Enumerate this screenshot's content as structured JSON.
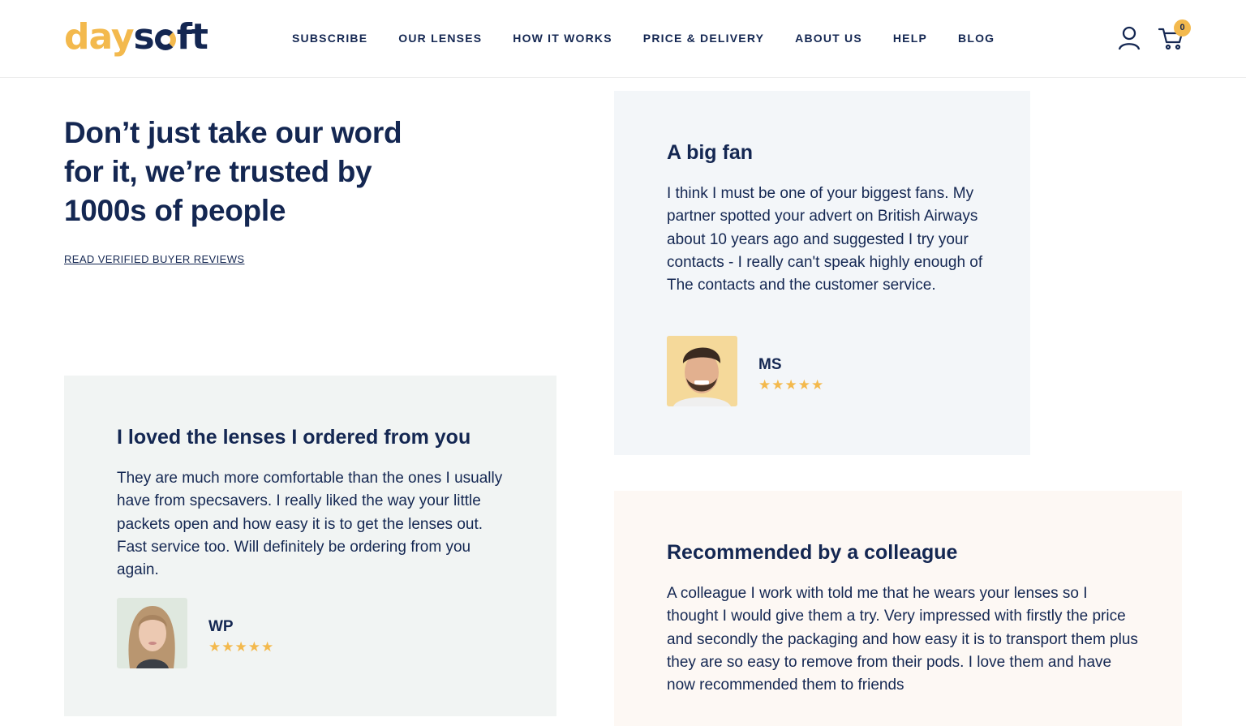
{
  "brand": {
    "logo_part1": "day",
    "logo_part2": "s",
    "logo_part3": "ft",
    "logo_primary_color": "#142752",
    "logo_accent_color": "#f3b94d"
  },
  "nav": {
    "items": [
      "SUBSCRIBE",
      "OUR LENSES",
      "HOW IT WORKS",
      "PRICE & DELIVERY",
      "ABOUT US",
      "HELP",
      "BLOG"
    ]
  },
  "header_icons": {
    "account": "user-icon",
    "cart": "cart-icon",
    "cart_count": "0"
  },
  "hero": {
    "headline": "Don’t just take our word for it, we’re trusted by 1000s of people",
    "link_label": "READ VERIFIED BUYER REVIEWS"
  },
  "reviews": [
    {
      "title": "A big fan",
      "body": "I think I must be one of your biggest fans. My partner spotted your advert on British Airways about 10 years ago and suggested I try your contacts - I really can't speak highly enough of The contacts and the customer service.",
      "initials": "MS",
      "rating": 5,
      "stars": "★★★★★",
      "background": "#f3f6f9"
    },
    {
      "title": "I loved the lenses I ordered from you",
      "body": "They are much more comfortable than the ones I usually have from specsavers. I really liked the way your little packets open and how easy it is to get the lenses out. Fast service too. Will definitely be ordering from you again.",
      "initials": "WP",
      "rating": 5,
      "stars": "★★★★★",
      "background": "#f1f4f3"
    },
    {
      "title": "Recommended by a colleague",
      "body": "A colleague I work with told me that he wears your lenses so I thought I would give them a try. Very impressed with firstly the price and secondly the packaging and how easy it is to transport them plus they are so easy to remove from their pods. I love them and have now recommended them to friends",
      "background": "#fdf8f4"
    }
  ]
}
